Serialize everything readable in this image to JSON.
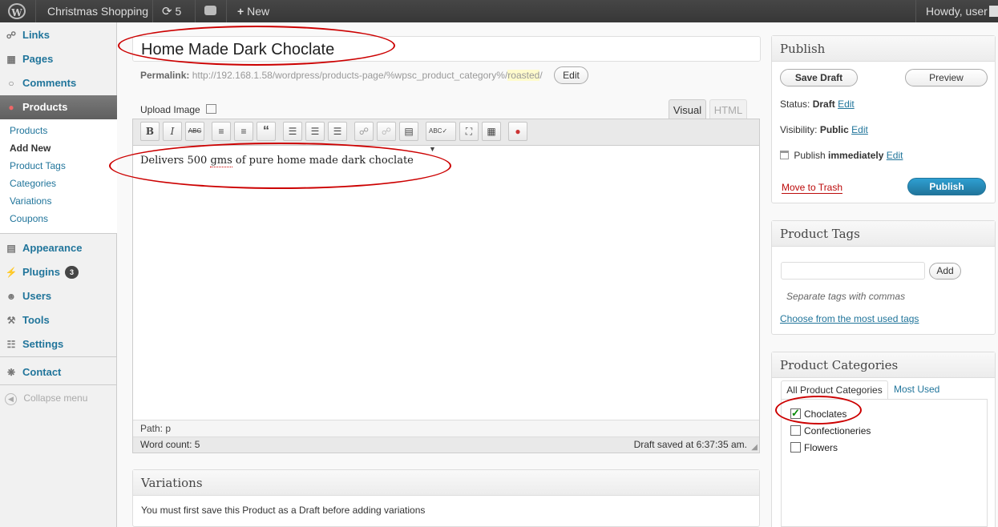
{
  "adminbar": {
    "site_name": "Christmas Shopping",
    "updates_count": "5",
    "new_label": "New",
    "howdy": "Howdy, user"
  },
  "sidebar": {
    "links": "Links",
    "pages": "Pages",
    "comments": "Comments",
    "products": "Products",
    "submenu": [
      "Products",
      "Add New",
      "Product Tags",
      "Categories",
      "Variations",
      "Coupons"
    ],
    "appearance": "Appearance",
    "plugins": "Plugins",
    "plugins_badge": "3",
    "users": "Users",
    "tools": "Tools",
    "settings": "Settings",
    "contact": "Contact",
    "collapse": "Collapse menu"
  },
  "editor": {
    "title_value": "Home Made Dark Choclate",
    "permalink_label": "Permalink:",
    "permalink_url": "http://192.168.1.58/wordpress/products-page/%wpsc_product_category%/",
    "permalink_slug": "roasted",
    "permalink_edit": "Edit",
    "upload_image": "Upload Image",
    "tab_visual": "Visual",
    "tab_html": "HTML",
    "content_pre": "Delivers 500 ",
    "content_misspelled": "gms",
    "content_post": " of pure home made dark choclate",
    "path_label": "Path:",
    "path_value": "p",
    "word_count": "Word count: 5",
    "draft_saved": "Draft saved at 6:37:35 am."
  },
  "variations": {
    "title": "Variations",
    "message": "You must first save this Product as a Draft before adding variations"
  },
  "publish": {
    "title": "Publish",
    "save_draft": "Save Draft",
    "preview": "Preview",
    "status_label": "Status:",
    "status_value": "Draft",
    "visibility_label": "Visibility:",
    "visibility_value": "Public",
    "publish_label": "Publish",
    "publish_value": "immediately",
    "edit": "Edit",
    "trash": "Move to Trash",
    "publish_button": "Publish"
  },
  "tags": {
    "title": "Product Tags",
    "input_value": "",
    "add": "Add",
    "hint": "Separate tags with commas",
    "choose": "Choose from the most used tags"
  },
  "categories": {
    "title": "Product Categories",
    "tab_all": "All Product Categories",
    "tab_most": "Most Used",
    "items": [
      {
        "label": "Choclates",
        "checked": true
      },
      {
        "label": "Confectioneries",
        "checked": false
      },
      {
        "label": "Flowers",
        "checked": false
      }
    ]
  },
  "colors": {
    "accent": "#21759b",
    "adminbar": "#464646",
    "annotation": "#cc0000"
  }
}
